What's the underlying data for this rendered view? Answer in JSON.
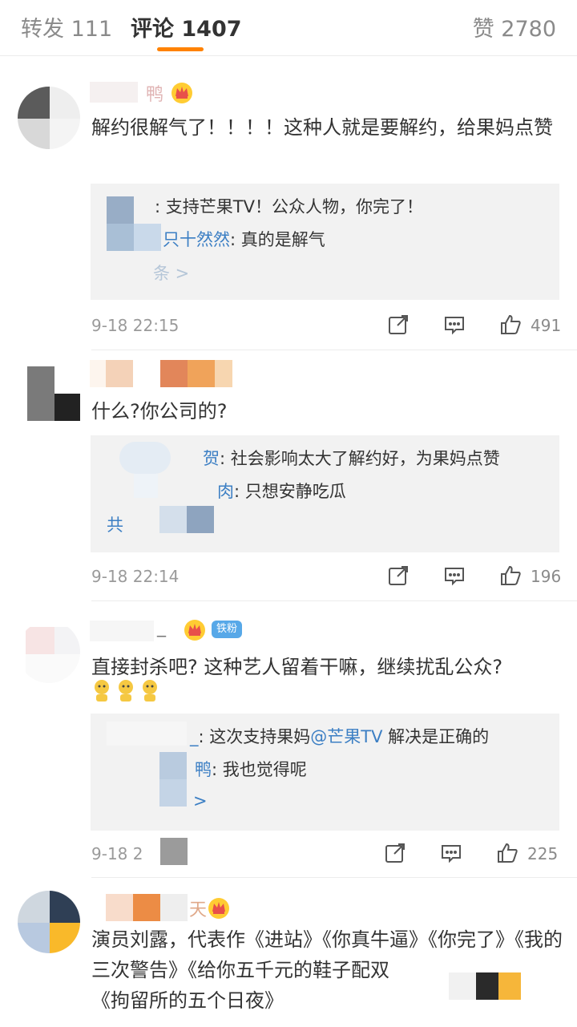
{
  "tabs": [
    {
      "label": "转发 111"
    },
    {
      "label": "评论 1407"
    },
    {
      "label": "赞 2780"
    }
  ],
  "colors": {
    "accent": "#ff8200",
    "link": "#3c7fc4",
    "reply_bg": "#f2f2f2",
    "fan_badge": "#57a8e8"
  },
  "comments": [
    {
      "username_visible": "鸭",
      "text": "解约很解气了！！！！这种人就是要解约，给果妈点赞",
      "replies": [
        {
          "name": "",
          "text": ": 支持芒果TV！公众人物，你完了！"
        },
        {
          "name": "只十然然",
          "text": ": 真的是解气"
        }
      ],
      "more": "条 >",
      "time": "9-18 22:15",
      "likes": "491"
    },
    {
      "username_visible": "",
      "text": "什么?你公司的?",
      "replies": [
        {
          "name": "贺",
          "text": ": 社会影响太大了解约好，为果妈点赞"
        },
        {
          "name": "肉",
          "text": ": 只想安静吃瓜"
        }
      ],
      "more": "共",
      "time": "9-18 22:14",
      "likes": "196"
    },
    {
      "username_visible": "_",
      "fan_badge": "铁粉",
      "text": "直接封杀吧? 这种艺人留着干嘛，继续扰乱公众?",
      "replies": [
        {
          "name": "_",
          "text": ": 这次支持果妈",
          "mention": "@芒果TV",
          "tail": " 解决是正确的"
        },
        {
          "name": "鸭",
          "text": ": 我也觉得呢"
        }
      ],
      "more": ">",
      "time": "9-18 2",
      "likes": "225"
    },
    {
      "username_visible": "天",
      "text": "演员刘露，代表作《进站》《你真牛逼》《你完了》《我的三次警告》《给你五千元的鞋子配双",
      "text2": "《拘留所的五个日夜》"
    }
  ],
  "icons": [
    "crown-icon",
    "share-icon",
    "comment-icon",
    "like-icon",
    "emoji-icon"
  ]
}
